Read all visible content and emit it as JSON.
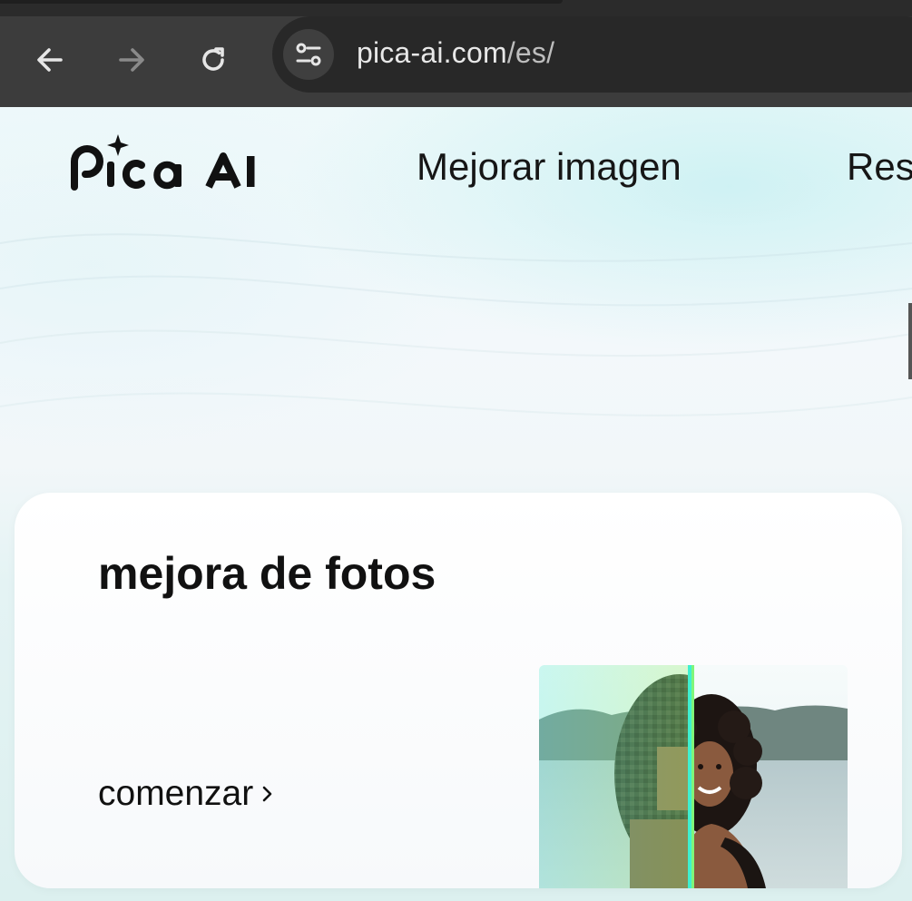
{
  "browser": {
    "url_host": "pica-ai.com",
    "url_path": "/es/"
  },
  "header": {
    "logo_text": "Pica AI",
    "nav": [
      {
        "label": "Mejorar imagen"
      },
      {
        "label": "Res"
      }
    ]
  },
  "card": {
    "title": "mejora de fotos",
    "cta_label": "comenzar",
    "cta_icon": "chevron-right-icon"
  },
  "colors": {
    "chrome_bg": "#3c3c3c",
    "omnibox_bg": "#282828",
    "divider_accent": "#3ef0d0"
  }
}
